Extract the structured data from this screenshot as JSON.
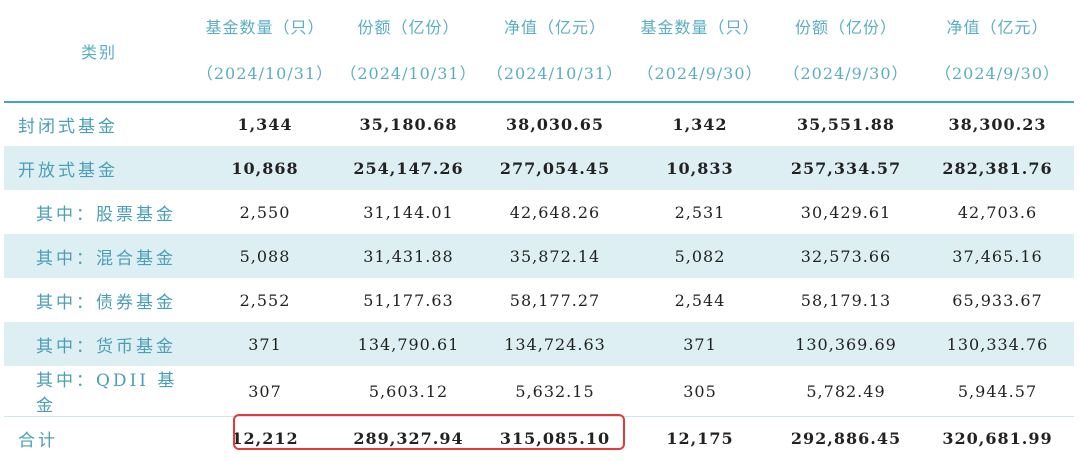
{
  "header": {
    "category": "类别",
    "columns": [
      {
        "line1": "基金数量（只）",
        "line2": "（2024/10/31）"
      },
      {
        "line1": "份额（亿份）",
        "line2": "（2024/10/31）"
      },
      {
        "line1": "净值（亿元）",
        "line2": "（2024/10/31）"
      },
      {
        "line1": "基金数量（只）",
        "line2": "（2024/9/30）"
      },
      {
        "line1": "份额（亿份）",
        "line2": "（2024/9/30）"
      },
      {
        "line1": "净值（亿元）",
        "line2": "（2024/9/30）"
      }
    ]
  },
  "rows": [
    {
      "label": "封闭式基金",
      "values": [
        "1,344",
        "35,180.68",
        "38,030.65",
        "1,342",
        "35,551.88",
        "38,300.23"
      ]
    },
    {
      "label": "开放式基金",
      "values": [
        "10,868",
        "254,147.26",
        "277,054.45",
        "10,833",
        "257,334.57",
        "282,381.76"
      ]
    },
    {
      "label": "其中：股票基金",
      "values": [
        "2,550",
        "31,144.01",
        "42,648.26",
        "2,531",
        "30,429.61",
        "42,703.6"
      ]
    },
    {
      "label": "其中：混合基金",
      "values": [
        "5,088",
        "31,431.88",
        "35,872.14",
        "5,082",
        "32,573.66",
        "37,465.16"
      ]
    },
    {
      "label": "其中：债券基金",
      "values": [
        "2,552",
        "51,177.63",
        "58,177.27",
        "2,544",
        "58,179.13",
        "65,933.67"
      ]
    },
    {
      "label": "其中：货币基金",
      "values": [
        "371",
        "134,790.61",
        "134,724.63",
        "371",
        "130,369.69",
        "130,334.76"
      ]
    },
    {
      "label": "其中：QDII 基金",
      "values": [
        "307",
        "5,603.12",
        "5,632.15",
        "305",
        "5,782.49",
        "5,944.57"
      ]
    },
    {
      "label": "合计",
      "values": [
        "12,212",
        "289,327.94",
        "315,085.10",
        "12,175",
        "292,886.45",
        "320,681.99"
      ]
    }
  ],
  "colors": {
    "header_text": "#5aaec4",
    "row_shade": "#ddeff3",
    "highlight_border": "#e23b3b"
  }
}
